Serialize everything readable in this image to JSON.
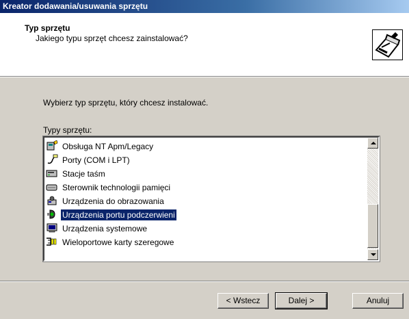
{
  "window": {
    "title": "Kreator dodawania/usuwania sprzętu"
  },
  "header": {
    "title": "Typ sprzętu",
    "subtitle": "Jakiego typu sprzęt chcesz zainstalować?"
  },
  "main": {
    "instruction": "Wybierz typ sprzętu, który chcesz instalować.",
    "list_label": "Typy sprzętu:",
    "list_items": [
      {
        "label": "Obsługa NT Apm/Legacy",
        "icon": "apm-legacy-icon"
      },
      {
        "label": "Porty (COM i LPT)",
        "icon": "port-icon"
      },
      {
        "label": "Stacje taśm",
        "icon": "tape-drive-icon"
      },
      {
        "label": "Sterownik technologii pamięci",
        "icon": "memory-tech-icon"
      },
      {
        "label": "Urządzenia do obrazowania",
        "icon": "imaging-device-icon"
      },
      {
        "label": "Urządzenia portu podczerwieni",
        "icon": "infrared-icon",
        "selected": true
      },
      {
        "label": "Urządzenia systemowe",
        "icon": "system-device-icon"
      },
      {
        "label": "Wieloportowe karty szeregowe",
        "icon": "multiport-serial-icon"
      }
    ]
  },
  "buttons": {
    "back": "< Wstecz",
    "next": "Dalej >",
    "cancel": "Anuluj"
  },
  "colors": {
    "titlebar": "#0a246a",
    "selection": "#0a246a",
    "dialog_bg": "#d4d0c8"
  }
}
